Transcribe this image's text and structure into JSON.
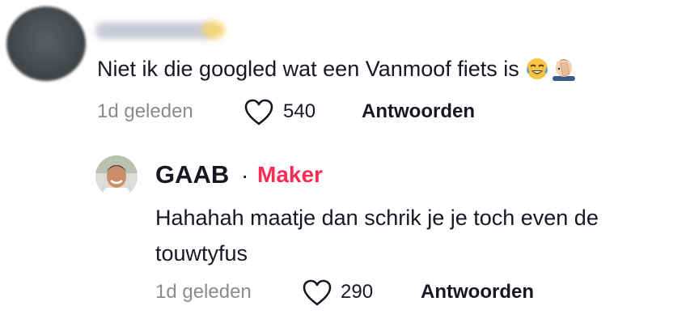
{
  "comment": {
    "author": "",
    "text": "Niet ik die googled wat een Vanmoof fiets is",
    "emojis": [
      "face-with-tears-of-joy-emoji",
      "facepalm-emoji"
    ],
    "time": "1d geleden",
    "likes": "540",
    "reply_label": "Antwoorden"
  },
  "reply": {
    "author": "GAAB",
    "separator": "·",
    "badge": "Maker",
    "text": "Hahahah maatje dan schrik je je toch even de touwtyfus",
    "time": "1d geleden",
    "likes": "290",
    "reply_label": "Antwoorden"
  },
  "colors": {
    "text": "#161823",
    "muted": "#8a8b91",
    "maker_badge": "#fe2c55"
  }
}
